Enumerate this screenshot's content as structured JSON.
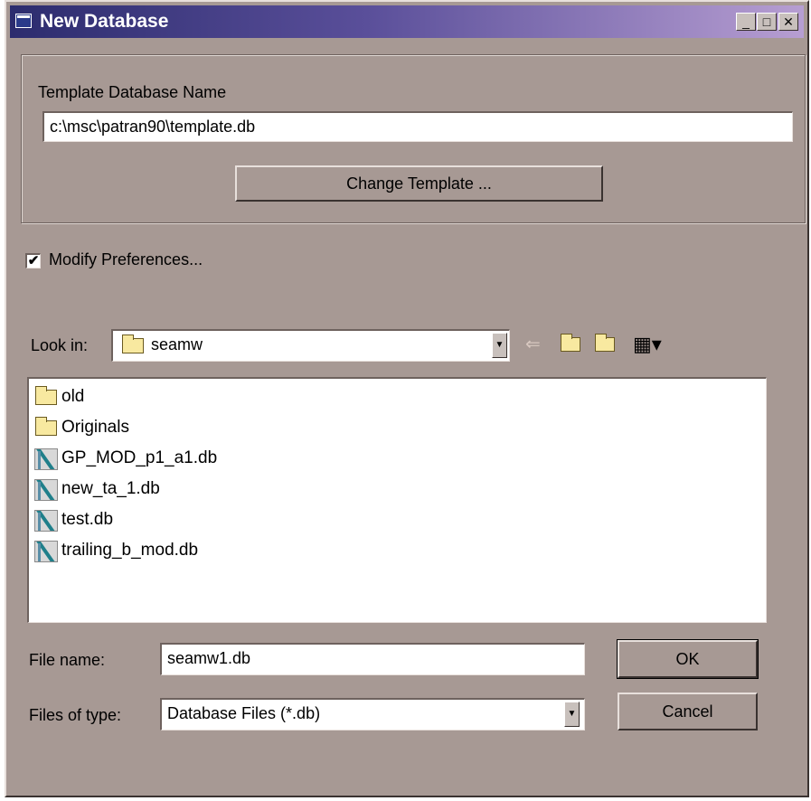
{
  "window": {
    "title": "New Database",
    "minimize": "_",
    "maximize": "□",
    "close": "✕"
  },
  "template": {
    "label": "Template Database Name",
    "value": "c:\\msc\\patran90\\template.db",
    "change_button": "Change Template ..."
  },
  "preferences": {
    "checked": true,
    "check_mark": "✔",
    "label": "Modify Preferences..."
  },
  "look_in": {
    "label": "Look in:",
    "value": "seamw",
    "icons": [
      "back-arrow-icon",
      "up-folder-icon",
      "new-folder-icon",
      "view-menu-icon"
    ]
  },
  "files": [
    {
      "name": "old",
      "type": "folder"
    },
    {
      "name": "Originals",
      "type": "folder"
    },
    {
      "name": "GP_MOD_p1_a1.db",
      "type": "db"
    },
    {
      "name": "new_ta_1.db",
      "type": "db"
    },
    {
      "name": "test.db",
      "type": "db"
    },
    {
      "name": "trailing_b_mod.db",
      "type": "db"
    }
  ],
  "file_name": {
    "label": "File name:",
    "value": "seamw1.db"
  },
  "file_type": {
    "label": "Files of type:",
    "value": "Database Files (*.db)"
  },
  "buttons": {
    "ok": "OK",
    "cancel": "Cancel"
  },
  "colors": {
    "dialog_bg": "#a79994",
    "title_start": "#2c2c6e",
    "title_end": "#b79ed2"
  }
}
